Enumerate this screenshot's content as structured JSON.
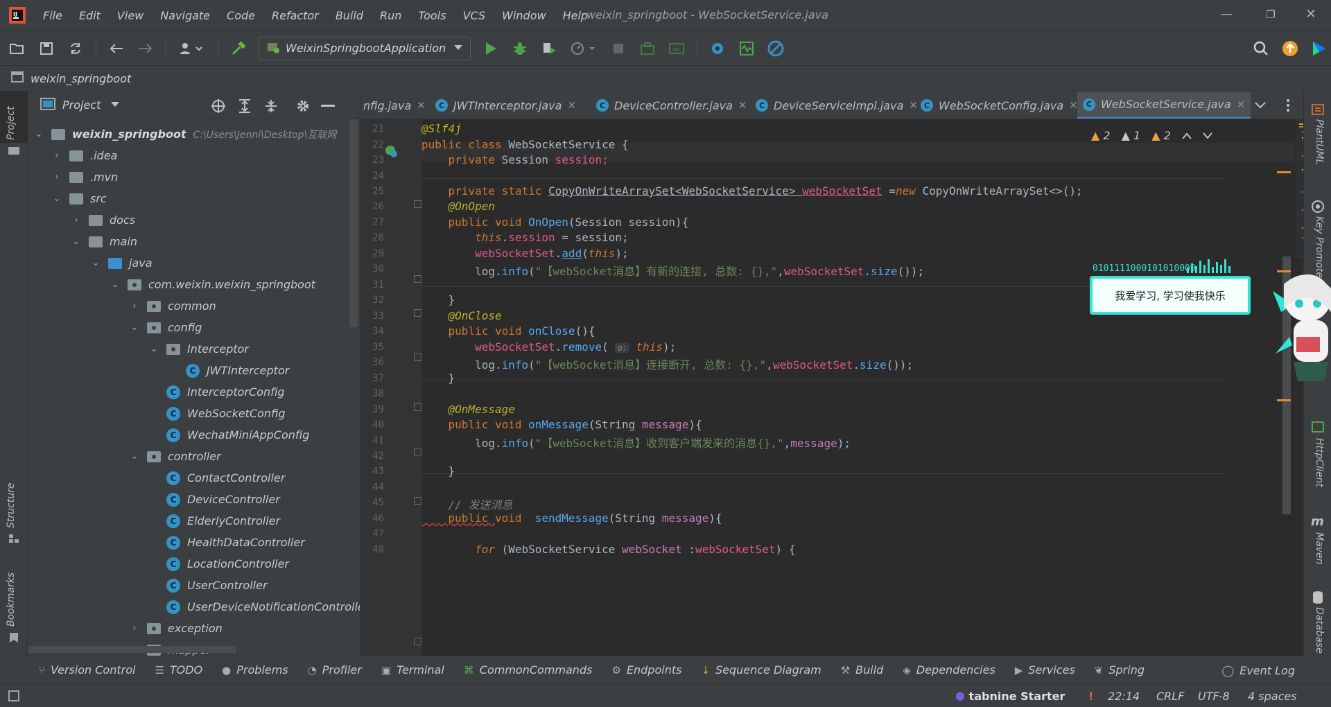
{
  "menu": [
    "File",
    "Edit",
    "View",
    "Navigate",
    "Code",
    "Refactor",
    "Build",
    "Run",
    "Tools",
    "VCS",
    "Window",
    "Help"
  ],
  "window_title": "weixin_springboot - WebSocketService.java",
  "window_controls": {
    "minimize": "—",
    "restore": "❐",
    "close": "✕"
  },
  "toolbar": {
    "run_config": "WeixinSpringbootApplication"
  },
  "breadcrumb": {
    "project": "weixin_springboot"
  },
  "left_strip": {
    "project": "Project",
    "structure": "Structure",
    "bookmarks": "Bookmarks"
  },
  "project_panel": {
    "title": "Project",
    "root": {
      "name": "weixin_springboot",
      "path": "C:\\Users\\Jenni\\Desktop\\互联网"
    },
    "items": [
      {
        "label": ".idea"
      },
      {
        "label": ".mvn"
      },
      {
        "label": "src"
      },
      {
        "label": "docs"
      },
      {
        "label": "main"
      },
      {
        "label": "java"
      },
      {
        "label": "com.weixin.weixin_springboot"
      },
      {
        "label": "common"
      },
      {
        "label": "config"
      },
      {
        "label": "Interceptor"
      },
      {
        "label": "JWTInterceptor"
      },
      {
        "label": "InterceptorConfig"
      },
      {
        "label": "WebSocketConfig"
      },
      {
        "label": "WechatMiniAppConfig"
      },
      {
        "label": "controller"
      },
      {
        "label": "ContactController"
      },
      {
        "label": "DeviceController"
      },
      {
        "label": "ElderlyController"
      },
      {
        "label": "HealthDataController"
      },
      {
        "label": "LocationController"
      },
      {
        "label": "UserController"
      },
      {
        "label": "UserDeviceNotificationController"
      },
      {
        "label": "exception"
      },
      {
        "label": "mapper"
      }
    ]
  },
  "tabs": [
    {
      "label": "nfig.java"
    },
    {
      "label": "JWTInterceptor.java"
    },
    {
      "label": "DeviceController.java"
    },
    {
      "label": "DeviceServiceImpl.java"
    },
    {
      "label": "WebSocketConfig.java"
    },
    {
      "label": "WebSocketService.java"
    }
  ],
  "inspections": {
    "warnings_a": "2",
    "warnings_b": "1",
    "warnings_c": "2"
  },
  "code": {
    "line_numbers": [
      "21",
      "22",
      "23",
      "24",
      "25",
      "26",
      "27",
      "28",
      "29",
      "30",
      "31",
      "32",
      "33",
      "34",
      "35",
      "36",
      "37",
      "38",
      "39",
      "40",
      "41",
      "42",
      "43",
      "44",
      "45",
      "46",
      "47",
      "48"
    ],
    "l21": "@Slf4j",
    "l22a": "public class ",
    "l22b": "WebSocketService {",
    "l23a": "    private ",
    "l23b": "Session ",
    "l23c": "session",
    "l23d": ";",
    "l25a": "    private static ",
    "l25b": "CopyOnWriteArraySet<WebSocketService> ",
    "l25c": "webSocketSet",
    "l25d": " =",
    "l25e": "new ",
    "l25f": "CopyOnWriteArraySet<>();",
    "l26": "    @OnOpen",
    "l27a": "    public void ",
    "l27b": "OnOpen",
    "l27c": "(Session session){",
    "l28a": "        this",
    "l28b": ".",
    "l28c": "session",
    "l28d": " = session;",
    "l29a": "        webSocketSet",
    "l29b": ".",
    "l29c": "add",
    "l29d": "(",
    "l29e": "this",
    "l29f": ");",
    "l30a": "        log.",
    "l30b": "info",
    "l30c": "(",
    "l30d": "\"【webSocket消息】有新的连接, 总数: {},\"",
    "l30e": ",",
    "l30f": "webSocketSet",
    "l30g": ".",
    "l30h": "size",
    "l30i": "());",
    "l32": "    }",
    "l33": "    @OnClose",
    "l34a": "    public void ",
    "l34b": "onClose",
    "l34c": "(){",
    "l35a": "        webSocketSet",
    "l35b": ".",
    "l35c": "remove",
    "l35d": "( ",
    "l35hint": "o:",
    "l35e": " this",
    "l35f": ");",
    "l36a": "        log.",
    "l36b": "info",
    "l36c": "(",
    "l36d": "\"【webSocket消息】连接断开, 总数: {},\"",
    "l36e": ",",
    "l36f": "webSocketSet",
    "l36g": ".",
    "l36h": "size",
    "l36i": "());",
    "l37": "    }",
    "l39": "    @OnMessage",
    "l40a": "    public void ",
    "l40b": "onMessage",
    "l40c": "(String ",
    "l40d": "message",
    "l40e": "){",
    "l41a": "        log.",
    "l41b": "info",
    "l41c": "(",
    "l41d": "\"【webSocket消息】收到客户端发来的消息{},\"",
    "l41e": ",",
    "l41f": "message",
    "l41g": ");",
    "l43": "    }",
    "l45": "    // 发送消息",
    "l46a": "    public ",
    "l46b": "void  ",
    "l46c": "sendMessage",
    "l46d": "(String ",
    "l46e": "message",
    "l46f": "){",
    "l48a": "        for ",
    "l48b": "(WebSocketService ",
    "l48c": "webSocket",
    "l48d": " :",
    "l48e": "webSocketSet",
    "l48f": ") {"
  },
  "bubble": {
    "binary": "0101111000101010000",
    "text": "我爱学习, 学习使我快乐"
  },
  "right_strip": {
    "plantuml": "PlantUML",
    "keypromoter": "Key Promoter",
    "httpclient": "HttpClient",
    "maven": "Maven",
    "database": "Database"
  },
  "bottom_tools": [
    {
      "icon": "⑂",
      "label": "Version Control"
    },
    {
      "icon": "☰",
      "label": "TODO"
    },
    {
      "icon": "●",
      "label": "Problems"
    },
    {
      "icon": "◔",
      "label": "Profiler"
    },
    {
      "icon": "▣",
      "label": "Terminal"
    },
    {
      "icon": "⌘",
      "label": "CommonCommands"
    },
    {
      "icon": "⚙",
      "label": "Endpoints"
    },
    {
      "icon": "⇣",
      "label": "Sequence Diagram"
    },
    {
      "icon": "⚒",
      "label": "Build"
    },
    {
      "icon": "◈",
      "label": "Dependencies"
    },
    {
      "icon": "▶",
      "label": "Services"
    },
    {
      "icon": "❦",
      "label": "Spring"
    }
  ],
  "event_log": "Event Log",
  "status": {
    "tabnine": "tabnine Starter",
    "alert": "!",
    "position": "22:14",
    "line_sep": "CRLF",
    "encoding": "UTF-8",
    "indent": "4 spaces"
  },
  "colors": {
    "accent": "#4a88c7",
    "bubble_border": "#31e6d6",
    "warning": "#e8a33d"
  }
}
